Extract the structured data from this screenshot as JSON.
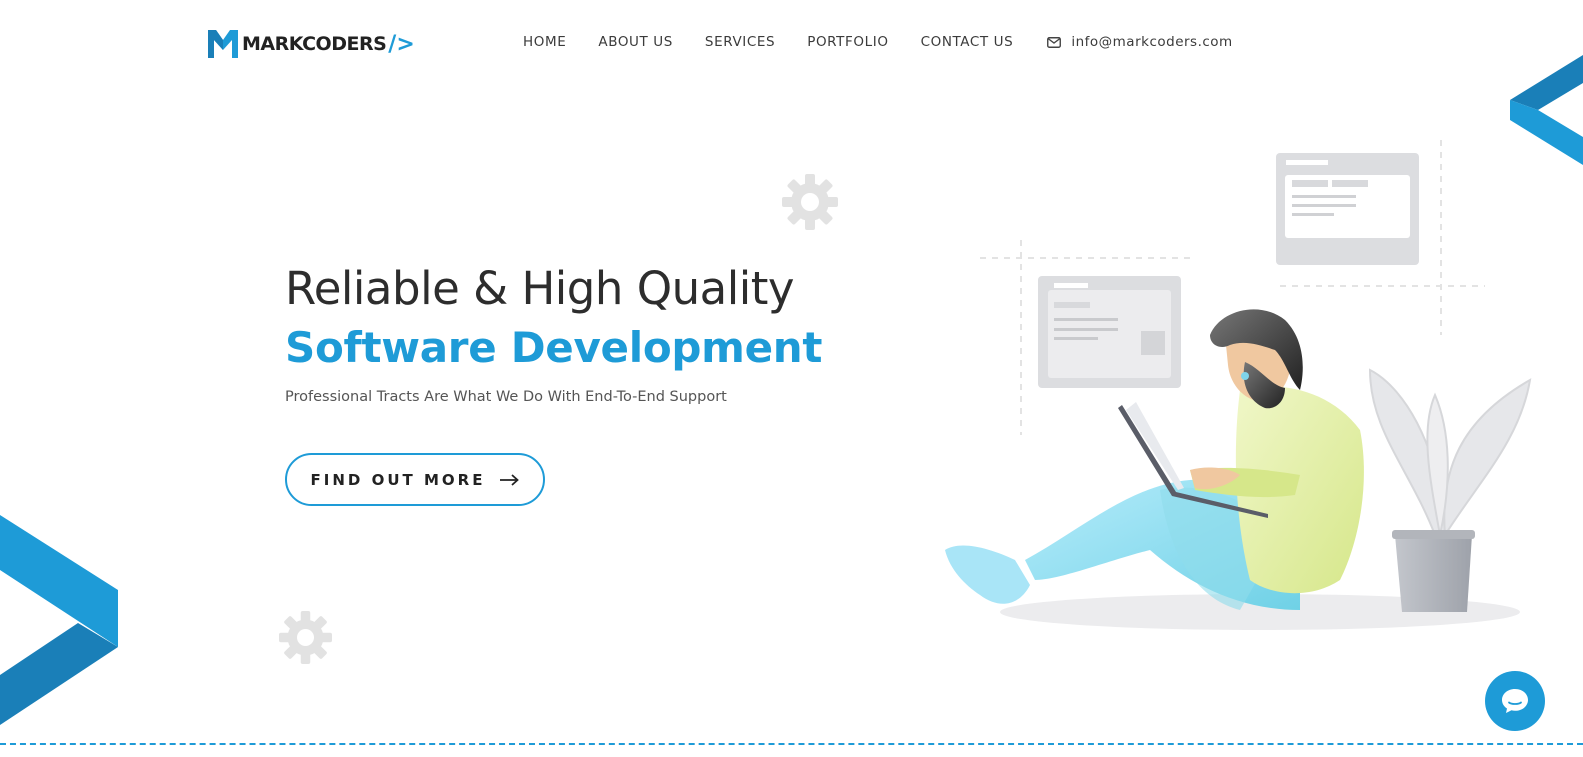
{
  "header": {
    "logo_text": "MARKCODERS",
    "logo_suffix": "/>",
    "nav": [
      {
        "label": "HOME"
      },
      {
        "label": "ABOUT US"
      },
      {
        "label": "SERVICES"
      },
      {
        "label": "PORTFOLIO"
      },
      {
        "label": "CONTACT US"
      }
    ],
    "email": "info@markcoders.com"
  },
  "hero": {
    "title_line1": "Reliable & High Quality",
    "title_line2": "Software Development",
    "subtitle": "Professional Tracts Are What We Do With End-To-End Support",
    "cta_label": "FIND OUT MORE"
  },
  "icons": {
    "logo": "logo-m-icon",
    "mail": "mail-icon",
    "arrow": "arrow-right-icon",
    "gear": "gear-icon",
    "chat": "chat-icon"
  },
  "colors": {
    "accent": "#1e9bd7",
    "accent_dark": "#1a7fb8",
    "text": "#2d2d2d",
    "gear": "#e2e2e2"
  }
}
